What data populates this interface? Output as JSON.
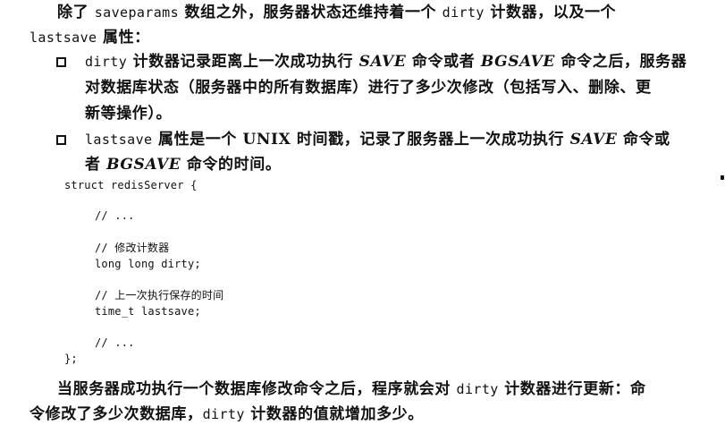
{
  "para1": {
    "l1_a": "除了 ",
    "l1_code": "saveparams",
    "l1_b": " 数组之外，服务器状态还维持着一个 ",
    "l1_code2": "dirty",
    "l1_c": " 计数器，以及一个",
    "l2_code": "lastsave",
    "l2_b": " 属性："
  },
  "bullets": [
    {
      "l1_code": "dirty",
      "l1_a": " 计数器记录距离上一次成功执行 ",
      "l1_it": "SAVE",
      "l1_b": " 命令或者 ",
      "l1_it2": "BGSAVE",
      "l1_c": " 命令之后，服务器",
      "l2": "对数据库状态（服务器中的所有数据库）进行了多少次修改（包括写入、删除、更",
      "l3": "新等操作）。"
    },
    {
      "l1_code": "lastsave",
      "l1_a": " 属性是一个 UNIX 时间戳，记录了服务器上一次成功执行 ",
      "l1_it": "SAVE",
      "l1_b": " 命令或",
      "l2_a": "者 ",
      "l2_it": "BGSAVE",
      "l2_b": " 命令的时间。"
    }
  ],
  "code": {
    "line1": "struct redisServer {",
    "line2": "// ...",
    "line3": "// 修改计数器",
    "line4": "long long dirty;",
    "line5": "// 上一次执行保存的时间",
    "line6": "time_t lastsave;",
    "line7": "// ...",
    "line8": "};"
  },
  "para2": {
    "l1_a": "当服务器成功执行一个数据库修改命令之后，程序就会对 ",
    "l1_code": "dirty",
    "l1_b": " 计数器进行更新：命",
    "l2_a": "令修改了多少次数据库，",
    "l2_code": "dirty",
    "l2_b": " 计数器的值就增加多少。"
  }
}
